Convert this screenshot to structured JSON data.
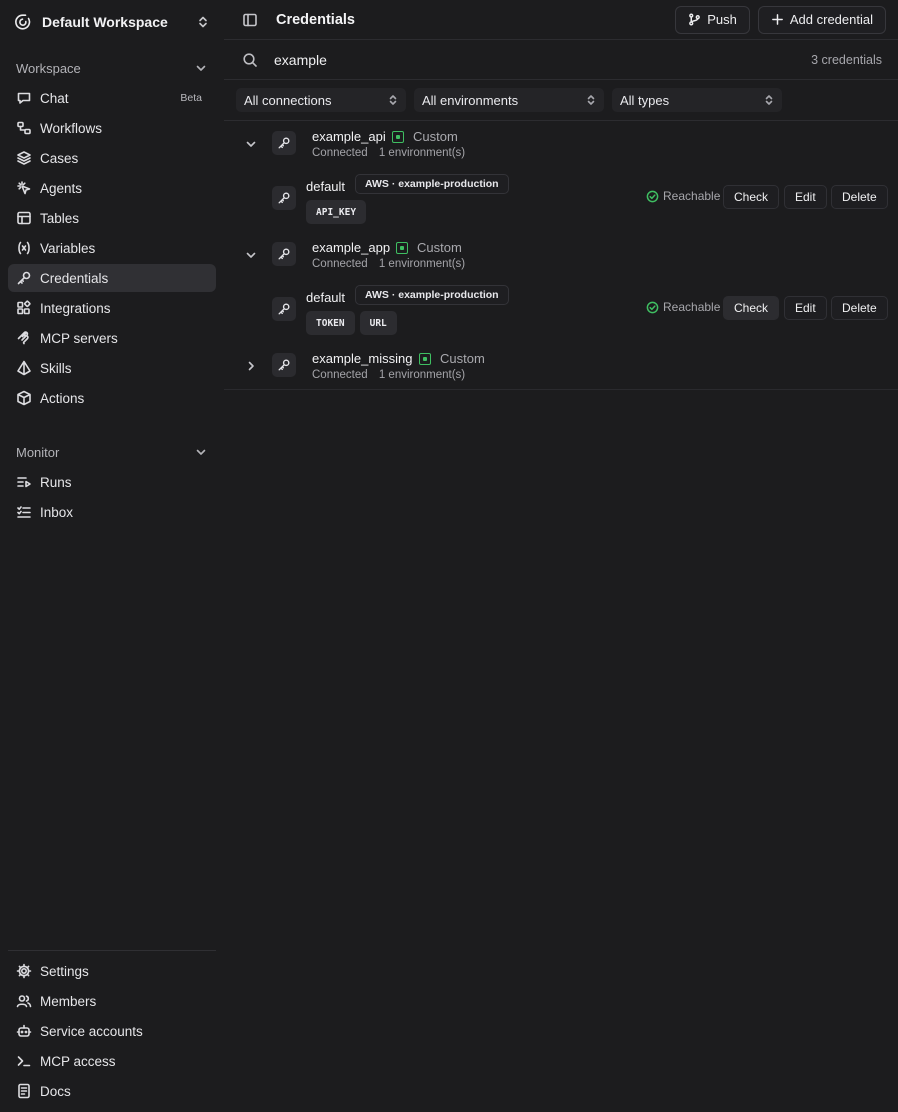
{
  "workspace": {
    "name": "Default Workspace"
  },
  "sidebar": {
    "workspace_section": "Workspace",
    "items": [
      {
        "label": "Chat",
        "icon": "chat-icon",
        "badge": "Beta"
      },
      {
        "label": "Workflows",
        "icon": "workflows-icon"
      },
      {
        "label": "Cases",
        "icon": "cases-icon"
      },
      {
        "label": "Agents",
        "icon": "agents-icon"
      },
      {
        "label": "Tables",
        "icon": "tables-icon"
      },
      {
        "label": "Variables",
        "icon": "variables-icon"
      },
      {
        "label": "Credentials",
        "icon": "key-icon",
        "active": true
      },
      {
        "label": "Integrations",
        "icon": "integrations-icon"
      },
      {
        "label": "MCP servers",
        "icon": "mcp-servers-icon"
      },
      {
        "label": "Skills",
        "icon": "skills-icon"
      },
      {
        "label": "Actions",
        "icon": "actions-icon"
      }
    ],
    "monitor_section": "Monitor",
    "monitor_items": [
      {
        "label": "Runs",
        "icon": "runs-icon"
      },
      {
        "label": "Inbox",
        "icon": "inbox-icon"
      }
    ],
    "bottom_items": [
      {
        "label": "Settings",
        "icon": "settings-icon"
      },
      {
        "label": "Members",
        "icon": "members-icon"
      },
      {
        "label": "Service accounts",
        "icon": "service-accounts-icon"
      },
      {
        "label": "MCP access",
        "icon": "terminal-icon"
      },
      {
        "label": "Docs",
        "icon": "docs-icon"
      }
    ]
  },
  "header": {
    "title": "Credentials",
    "push_label": "Push",
    "add_label": "Add credential"
  },
  "search": {
    "value": "example",
    "count": "3 credentials"
  },
  "filters": {
    "connections": "All connections",
    "environments": "All environments",
    "types": "All types"
  },
  "credentials": [
    {
      "name": "example_api",
      "type": "Custom",
      "status": "Connected",
      "envs": "1 environment(s)",
      "expanded": true,
      "environment": {
        "name": "default",
        "tag": "AWS · example-production",
        "keys": [
          "API_KEY"
        ],
        "reach": "Reachable"
      }
    },
    {
      "name": "example_app",
      "type": "Custom",
      "status": "Connected",
      "envs": "1 environment(s)",
      "expanded": true,
      "environment": {
        "name": "default",
        "tag": "AWS · example-production",
        "keys": [
          "TOKEN",
          "URL"
        ],
        "reach": "Reachable"
      }
    },
    {
      "name": "example_missing",
      "type": "Custom",
      "status": "Connected",
      "envs": "1 environment(s)",
      "expanded": false
    }
  ],
  "actions": {
    "check": "Check",
    "edit": "Edit",
    "delete": "Delete"
  },
  "colors": {
    "background": "#1c1c1e",
    "active_nav": "#303034",
    "custom_accent": "#3fbf62",
    "reachable": "#3fbf62"
  }
}
